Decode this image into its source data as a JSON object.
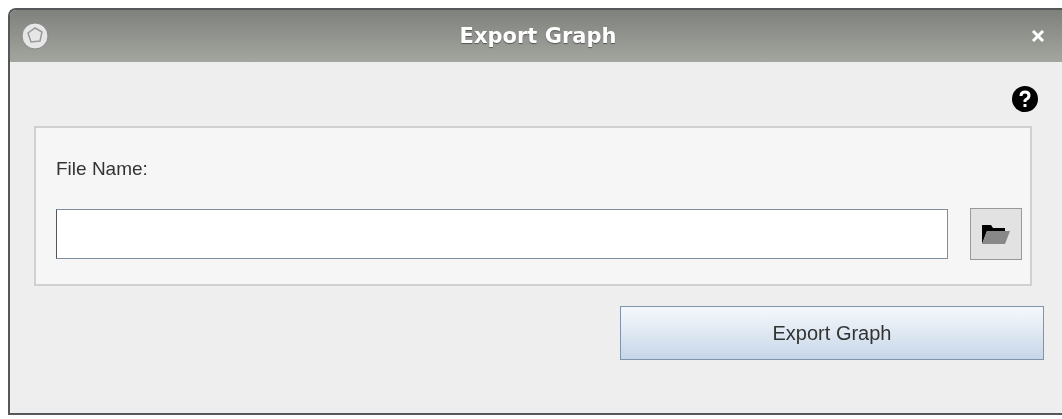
{
  "window": {
    "title": "Export Graph"
  },
  "form": {
    "file_name_label": "File Name:"
  },
  "buttons": {
    "export": "Export Graph"
  }
}
